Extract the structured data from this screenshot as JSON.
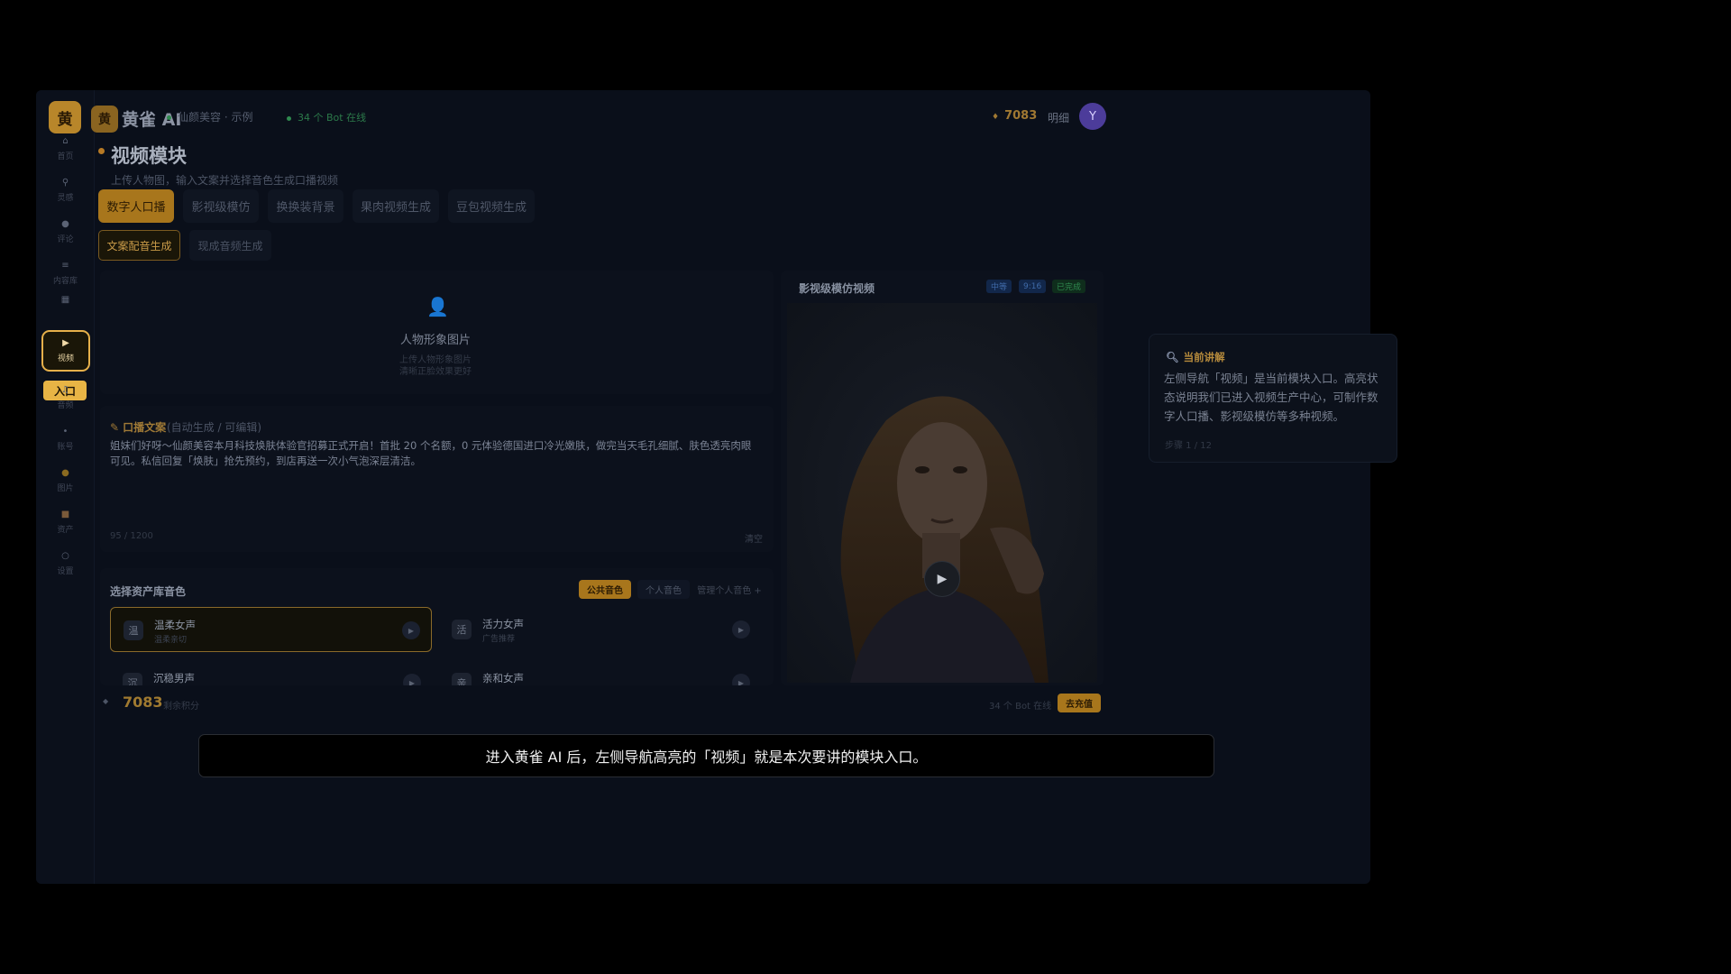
{
  "app": {
    "brand_char": "黄",
    "title": "黄雀 AI",
    "workspace": "仙颜美容 · 示例",
    "bots_online": "34 个 Bot 在线",
    "coins": "7083",
    "detail_label": "明细",
    "avatar_letter": "Y"
  },
  "sidebar": {
    "items": [
      {
        "icon": "⌂",
        "label": "首页"
      },
      {
        "icon": "⚲",
        "label": "灵感"
      },
      {
        "icon": "●",
        "label": "评论"
      },
      {
        "icon": "≡",
        "label": "内容库"
      },
      {
        "icon": "▦",
        "label": ""
      },
      {
        "icon": "▶",
        "label": "视频"
      },
      {
        "icon": "♫",
        "label": "音频"
      },
      {
        "icon": "•",
        "label": "账号"
      },
      {
        "icon": "●",
        "label": "图片"
      },
      {
        "icon": "■",
        "label": "资产"
      },
      {
        "icon": "○",
        "label": "设置"
      }
    ],
    "entry_badge": "入口"
  },
  "page": {
    "title": "视频模块",
    "subtitle": "上传人物图，输入文案并选择音色生成口播视频",
    "tabs": [
      "数字人口播",
      "影视级模仿",
      "换换装背景",
      "果肉视频生成",
      "豆包视频生成"
    ],
    "subtabs": [
      "文案配音生成",
      "现成音频生成"
    ]
  },
  "upload": {
    "title": "人物形象图片",
    "hint1": "上传人物形象图片",
    "hint2": "清晰正脸效果更好"
  },
  "copy": {
    "label": "口播文案",
    "note": "(自动生成 / 可编辑)",
    "text": "姐妹们好呀～仙颜美容本月科技焕肤体验官招募正式开启！首批 20 个名额，0 元体验德国进口冷光嫩肤，做完当天毛孔细腻、肤色透亮肉眼可见。私信回复「焕肤」抢先预约，到店再送一次小气泡深层清洁。",
    "count": "95 / 1200",
    "clear": "清空"
  },
  "voices": {
    "title": "选择资产库音色",
    "tabs": [
      "公共音色",
      "个人音色",
      "管理个人音色 +"
    ],
    "cards": [
      {
        "icon": "温",
        "name": "温柔女声",
        "desc": "温柔亲切"
      },
      {
        "icon": "活",
        "name": "活力女声",
        "desc": "广告推荐"
      },
      {
        "icon": "沉",
        "name": "沉稳男声",
        "desc": ""
      },
      {
        "icon": "亲",
        "name": "亲和女声",
        "desc": ""
      }
    ]
  },
  "video": {
    "title": "影视级模仿视频",
    "badges": [
      "中等",
      "9:16",
      "已完成"
    ]
  },
  "bottom": {
    "coins": "7083",
    "coin_label": "剩余积分",
    "bots": "34 个 Bot 在线",
    "recharge": "去充值"
  },
  "explain": {
    "heading": "当前讲解",
    "body": "左侧导航「视频」是当前模块入口。高亮状态说明我们已进入视频生产中心，可制作数字人口播、影视级模仿等多种视频。",
    "step": "步骤 1 / 12"
  },
  "caption": "进入黄雀 AI 后，左侧导航高亮的「视频」就是本次要讲的模块入口。",
  "colors": {
    "accent": "#e8b445",
    "brand_gold": "#a8761c",
    "online_green": "#2f8a4f",
    "badge_blue": "#1c3a63",
    "badge_green": "#153a25"
  }
}
